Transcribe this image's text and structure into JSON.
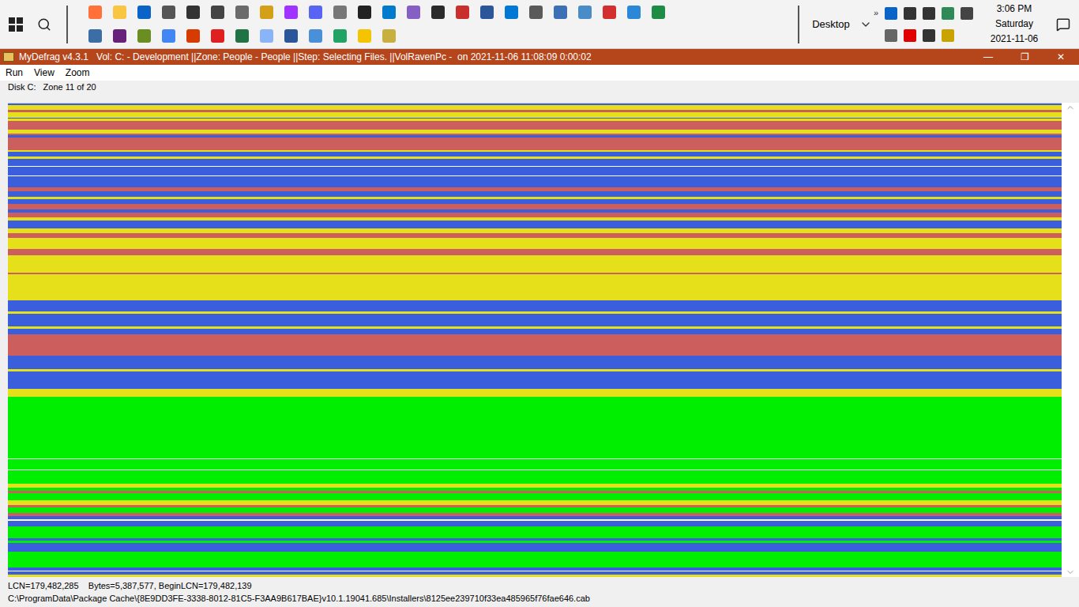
{
  "taskbar": {
    "pinned_rows": [
      [
        {
          "color": "#ff7139"
        },
        {
          "color": "#f8c640"
        },
        {
          "color": "#0a64c8"
        },
        {
          "color": "#555555"
        },
        {
          "color": "#333333"
        },
        {
          "color": "#444444"
        },
        {
          "color": "#6b6b6b"
        },
        {
          "color": "#d4a017"
        },
        {
          "color": "#a033ff"
        },
        {
          "color": "#5865f2"
        },
        {
          "color": "#777777"
        },
        {
          "color": "#222222"
        },
        {
          "color": "#007acc"
        },
        {
          "color": "#865fc5"
        },
        {
          "color": "#2a2a2a"
        },
        {
          "color": "#c9302c"
        },
        {
          "color": "#2b579a"
        },
        {
          "color": "#0078d4"
        },
        {
          "color": "#5a5a5a"
        },
        {
          "color": "#3b6fb6"
        },
        {
          "color": "#4a8cc7"
        },
        {
          "color": "#d32f2f"
        },
        {
          "color": "#2b88d8"
        },
        {
          "color": "#1e8c45"
        }
      ],
      [
        {
          "color": "#3a6ea5"
        },
        {
          "color": "#68217a"
        },
        {
          "color": "#6b8e23"
        },
        {
          "color": "#4285f4"
        },
        {
          "color": "#d83b01"
        },
        {
          "color": "#e02020"
        },
        {
          "color": "#217346"
        },
        {
          "color": "#8ab4f8"
        },
        {
          "color": "#2b579a"
        },
        {
          "color": "#4a90d9"
        },
        {
          "color": "#21a366"
        },
        {
          "color": "#f5c400"
        },
        {
          "color": "#c8b040"
        }
      ]
    ],
    "overflow": "»",
    "toolbar": "Desktop",
    "tray_rows": [
      [
        {
          "color": "#0a64c8"
        },
        {
          "color": "#333333"
        },
        {
          "color": "#333333"
        },
        {
          "color": "#2e8b57"
        },
        {
          "color": "#444444"
        }
      ],
      [
        {
          "color": "#666666"
        },
        {
          "color": "#e00000"
        },
        {
          "color": "#333333"
        },
        {
          "color": "#c9a400"
        }
      ]
    ],
    "clock": {
      "time": "3:06 PM",
      "day": "Saturday",
      "date": "2021-11-06"
    }
  },
  "window": {
    "title": "MyDefrag v4.3.1   Vol: C: - Development ||Zone: People - People ||Step: Selecting Files. ||VolRavenPc -  on 2021-11-06 11:08:09 0:00:02",
    "controls": [
      "—",
      "❐",
      "✕"
    ],
    "menu": [
      "Run",
      "View",
      "Zoom"
    ],
    "zone_label": "Disk C:   Zone 11 of 20",
    "map": {
      "bands": [
        {
          "color": "#3b5fdc",
          "rows": 2
        },
        {
          "color": "#e6e01a",
          "rows": 5
        },
        {
          "color": "#cc5e5e",
          "rows": 3
        },
        {
          "color": "#e6e01a",
          "rows": 6
        },
        {
          "color": "#3b5fdc",
          "rows": 1
        },
        {
          "color": "#e6e01a",
          "rows": 3
        },
        {
          "color": "#cc5e5e",
          "rows": 10
        },
        {
          "color": "#e6e01a",
          "rows": 4
        },
        {
          "color": "#cc5e5e",
          "rows": 2
        },
        {
          "color": "#3b5fdc",
          "rows": 3
        },
        {
          "color": "#cc5e5e",
          "rows": 14
        },
        {
          "color": "#e6e01a",
          "rows": 2
        },
        {
          "color": "#3b5fdc",
          "rows": 5
        },
        {
          "color": "#e6e01a",
          "rows": 3
        },
        {
          "color": "#3b5fdc",
          "rows": 8
        },
        {
          "color": "#ffffff",
          "rows": 1
        },
        {
          "color": "#3b5fdc",
          "rows": 10
        },
        {
          "color": "#ffffff",
          "rows": 1
        },
        {
          "color": "#3b5fdc",
          "rows": 12
        },
        {
          "color": "#cc5e5e",
          "rows": 5
        },
        {
          "color": "#3b5fdc",
          "rows": 6
        },
        {
          "color": "#e6e01a",
          "rows": 3
        },
        {
          "color": "#3b5fdc",
          "rows": 5
        },
        {
          "color": "#cc5e5e",
          "rows": 6
        },
        {
          "color": "#3b5fdc",
          "rows": 4
        },
        {
          "color": "#cc5e5e",
          "rows": 5
        },
        {
          "color": "#e6e01a",
          "rows": 4
        },
        {
          "color": "#3b5fdc",
          "rows": 9
        },
        {
          "color": "#e6e01a",
          "rows": 5
        },
        {
          "color": "#cc5e5e",
          "rows": 6
        },
        {
          "color": "#e6e01a",
          "rows": 12
        },
        {
          "color": "#cc5e5e",
          "rows": 7
        },
        {
          "color": "#e6e01a",
          "rows": 20
        },
        {
          "color": "#cc5e5e",
          "rows": 2
        },
        {
          "color": "#e6e01a",
          "rows": 30
        },
        {
          "color": "#3b5fdc",
          "rows": 12
        },
        {
          "color": "#e6e01a",
          "rows": 3
        },
        {
          "color": "#3b5fdc",
          "rows": 14
        },
        {
          "color": "#e6e01a",
          "rows": 3
        },
        {
          "color": "#3b5fdc",
          "rows": 6
        },
        {
          "color": "#cc5e5e",
          "rows": 24
        },
        {
          "color": "#3b5fdc",
          "rows": 16
        },
        {
          "color": "#e6e01a",
          "rows": 2
        },
        {
          "color": "#3b5fdc",
          "rows": 20
        },
        {
          "color": "#e6e01a",
          "rows": 9
        },
        {
          "color": "#00ee00",
          "rows": 70
        },
        {
          "color": "#ffffff",
          "rows": 1
        },
        {
          "color": "#00ee00",
          "rows": 12
        },
        {
          "color": "#ffffff",
          "rows": 1
        },
        {
          "color": "#00ee00",
          "rows": 15
        },
        {
          "color": "#e6e01a",
          "rows": 4
        },
        {
          "color": "#00ee00",
          "rows": 4
        },
        {
          "color": "#cc5e5e",
          "rows": 3
        },
        {
          "color": "#00ee00",
          "rows": 8
        },
        {
          "color": "#e6e01a",
          "rows": 5
        },
        {
          "color": "#cc5e5e",
          "rows": 3
        },
        {
          "color": "#00ee00",
          "rows": 6
        },
        {
          "color": "#cc5e5e",
          "rows": 4
        },
        {
          "color": "#3b5fdc",
          "rows": 3
        },
        {
          "color": "#ffffff",
          "rows": 2
        },
        {
          "color": "#3b5fdc",
          "rows": 6
        },
        {
          "color": "#00ee00",
          "rows": 14
        },
        {
          "color": "#3b5fdc",
          "rows": 3
        },
        {
          "color": "#00ee00",
          "rows": 2
        },
        {
          "color": "#3b5fdc",
          "rows": 10
        },
        {
          "color": "#00ee00",
          "rows": 18
        },
        {
          "color": "#3b5fdc",
          "rows": 4
        },
        {
          "color": "#ffffff",
          "rows": 1
        },
        {
          "color": "#3b5fdc",
          "rows": 3
        },
        {
          "color": "#e6e01a",
          "rows": 3
        }
      ]
    },
    "status_bar": {
      "position": "LCN=179,482,285    Bytes=5,387,577, BeginLCN=179,482,139",
      "path": "C:\\ProgramData\\Package Cache\\{8E9DD3FE-3338-8012-81C5-F3AA9B617BAE}v10.1.19041.685\\Installers\\8125ee239710f33ea485965f76fae646.cab"
    }
  }
}
